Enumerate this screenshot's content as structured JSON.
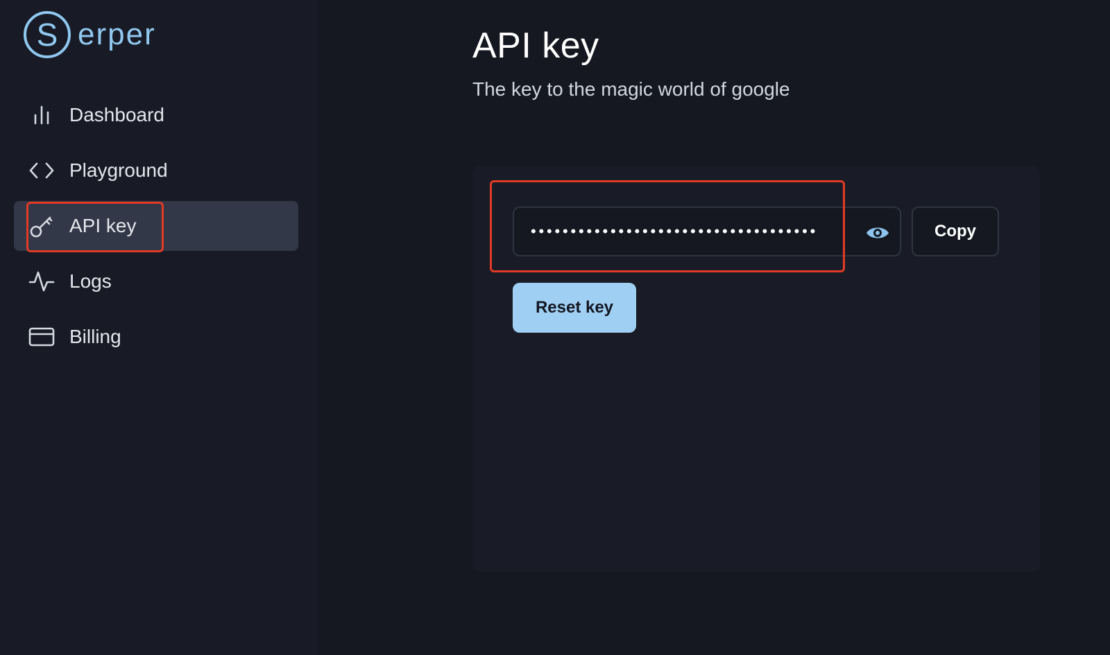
{
  "app": {
    "logo_letter": "S",
    "logo_text": "erper",
    "accent_color": "#90c8f0"
  },
  "sidebar": {
    "items": [
      {
        "label": "Dashboard",
        "icon": "bar-chart-icon",
        "active": false
      },
      {
        "label": "Playground",
        "icon": "code-icon",
        "active": false
      },
      {
        "label": "API key",
        "icon": "key-icon",
        "active": true
      },
      {
        "label": "Logs",
        "icon": "activity-icon",
        "active": false
      },
      {
        "label": "Billing",
        "icon": "credit-card-icon",
        "active": false
      }
    ]
  },
  "main": {
    "title": "API key",
    "subtitle": "The key to the magic world of google",
    "key_field": {
      "masked_value": "••••••••••••••••••••••••••••••••••••",
      "reveal_icon": "eye-icon"
    },
    "copy_label": "Copy",
    "reset_label": "Reset key",
    "reset_color": "#9fd0f4"
  },
  "annotations": {
    "highlight_color": "#e23b25"
  }
}
